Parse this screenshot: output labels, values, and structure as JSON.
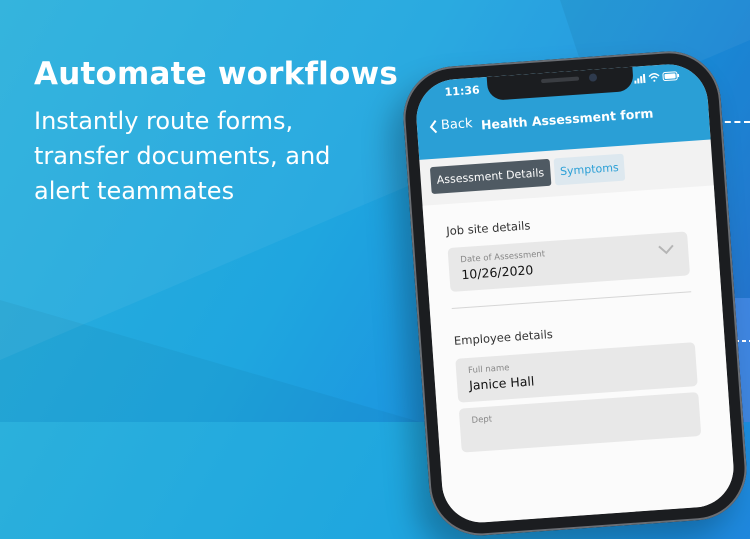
{
  "promo": {
    "headline": "Automate workflows",
    "sub_lines": [
      "Instantly route forms,",
      "transfer documents, and",
      "alert teammates"
    ]
  },
  "phone": {
    "status_time": "11:36",
    "status_icons": [
      "signal-icon",
      "wifi-icon",
      "battery-icon"
    ],
    "nav": {
      "back_label": "Back",
      "title": "Health Assessment form"
    },
    "tabs": [
      {
        "label": "Assessment Details",
        "active": true
      },
      {
        "label": "Symptoms",
        "active": false
      }
    ],
    "sections": {
      "job_site": {
        "title": "Job site details",
        "date_field": {
          "label": "Date of Assessment",
          "value": "10/26/2020"
        }
      },
      "employee": {
        "title": "Employee details",
        "name_field": {
          "label": "Full name",
          "value": "Janice Hall"
        },
        "dept_field": {
          "label": "Dept"
        }
      }
    }
  },
  "colors": {
    "header_blue": "#2a9fd6",
    "active_tab": "#4f5a63",
    "background_blue": "#1fa6df"
  }
}
